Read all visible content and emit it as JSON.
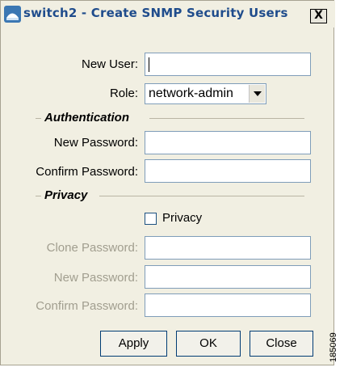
{
  "window": {
    "title": "switch2 - Create SNMP Security Users",
    "close_glyph": "X",
    "icon": "switch-app-icon"
  },
  "form": {
    "new_user": {
      "label": "New User:",
      "value": ""
    },
    "role": {
      "label": "Role:",
      "value": "network-admin",
      "icon": "chevron-down-icon"
    }
  },
  "authentication": {
    "title": "Authentication",
    "new_password": {
      "label": "New Password:",
      "value": ""
    },
    "confirm_password": {
      "label": "Confirm Password:",
      "value": ""
    }
  },
  "privacy": {
    "title": "Privacy",
    "checkbox_label": "Privacy",
    "checked": false,
    "clone_password": {
      "label": "Clone Password:",
      "value": ""
    },
    "new_password": {
      "label": "New Password:",
      "value": ""
    },
    "confirm_password": {
      "label": "Confirm Password:",
      "value": ""
    }
  },
  "buttons": {
    "apply": "Apply",
    "ok": "OK",
    "close": "Close"
  },
  "figure_id": "185069"
}
